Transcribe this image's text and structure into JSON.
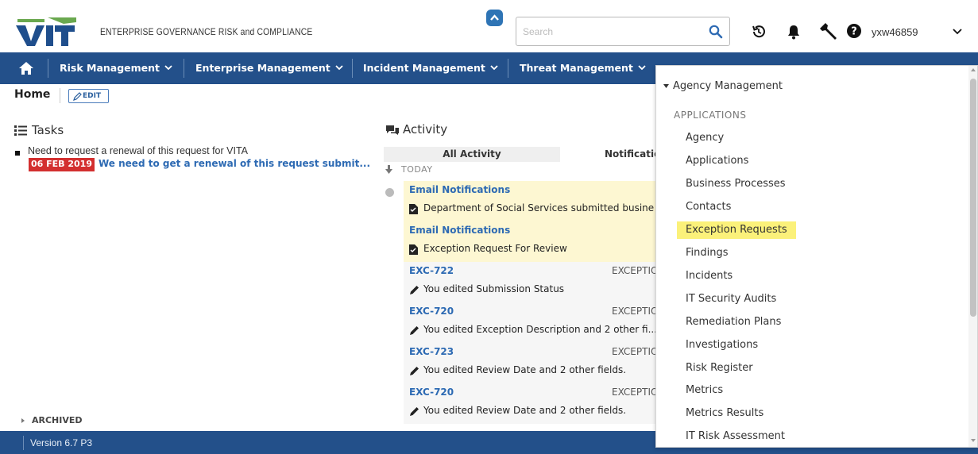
{
  "header": {
    "app_title": "ENTERPRISE GOVERNANCE RISK and COMPLIANCE",
    "search_placeholder": "Search",
    "user_name": "yxw46859",
    "logo_text": "VITA"
  },
  "nav": {
    "items": [
      {
        "label": "Risk Management"
      },
      {
        "label": "Enterprise Management"
      },
      {
        "label": "Incident Management"
      },
      {
        "label": "Threat Management"
      }
    ]
  },
  "breadcrumb": {
    "home": "Home",
    "edit": "EDIT"
  },
  "tasks": {
    "title": "Tasks",
    "items": [
      {
        "text": "Need to request a renewal of this request for VITA",
        "date": "06 FEB 2019",
        "link": "We need to get a renewal of this request submit..."
      }
    ],
    "archived": "ARCHIVED"
  },
  "activity": {
    "title": "Activity",
    "tabs": [
      "All Activity",
      "Notificatio"
    ],
    "today_label": "TODAY",
    "entries": [
      {
        "title": "Email Notifications",
        "type": "",
        "description": "Department of Social Services submitted busine"
      },
      {
        "title": "Email Notifications",
        "type": "",
        "description": "Exception Request For Review"
      },
      {
        "title": "EXC-722",
        "type": "EXCEPTIO",
        "description": "You edited Submission Status"
      },
      {
        "title": "EXC-720",
        "type": "EXCEPTIO",
        "description": "You edited Exception Description and 2 other fi..."
      },
      {
        "title": "EXC-723",
        "type": "EXCEPTIO",
        "description": "You edited Review Date and 2 other fields."
      },
      {
        "title": "EXC-720",
        "type": "EXCEPTIO",
        "description": "You edited Review Date and 2 other fields."
      }
    ]
  },
  "dropdown": {
    "header": "Agency Management",
    "section": "APPLICATIONS",
    "items": [
      "Agency",
      "Applications",
      "Business Processes",
      "Contacts",
      "Exception Requests",
      "Findings",
      "Incidents",
      "IT Security Audits",
      "Remediation Plans",
      "Investigations",
      "Risk Register",
      "Metrics",
      "Metrics Results",
      "IT Risk Assessment"
    ],
    "selected": "Exception Requests"
  },
  "footer": {
    "version": "Version 6.7 P3"
  },
  "colors": {
    "nav_bg": "#23508a",
    "link": "#2d6ab3",
    "highlight": "#fbf17a",
    "date_badge": "#d32f2f"
  }
}
